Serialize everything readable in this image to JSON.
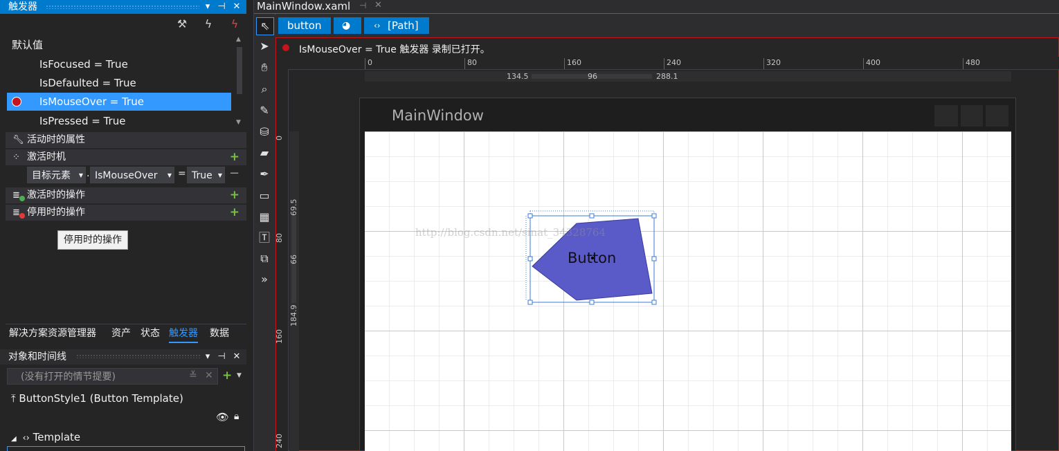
{
  "triggers_panel": {
    "title": "触发器",
    "default_label": "默认值",
    "triggers": [
      {
        "label": "IsFocused = True",
        "selected": false
      },
      {
        "label": "IsDefaulted = True",
        "selected": false
      },
      {
        "label": "IsMouseOver = True",
        "selected": true
      },
      {
        "label": "IsPressed = True",
        "selected": false
      }
    ],
    "sections": {
      "active_properties": "活动时的属性",
      "activation_timing": "激活时机",
      "activation_actions": "激活时的操作",
      "deactivation_actions": "停用时的操作"
    },
    "condition": {
      "target": "目标元素",
      "dot": ".",
      "property": "IsMouseOver",
      "equals": "=",
      "value": "True"
    },
    "tooltip": "停用时的操作"
  },
  "bottom_tabs": [
    "解决方案资源管理器",
    "资产",
    "状态",
    "触发器",
    "数据"
  ],
  "active_bottom_tab": "触发器",
  "objects_panel": {
    "title": "对象和时间线",
    "storyboard_placeholder": "(没有打开的情节提要)",
    "scope_label": "ButtonStyle1 (Button Template)",
    "tree_item": "Template"
  },
  "document": {
    "tab_title": "MainWindow.xaml",
    "breadcrumbs": [
      "button",
      "[Path]"
    ],
    "recording_status": "IsMouseOver = True 触发器 录制已打开。",
    "ruler_h_labels": [
      "0",
      "80",
      "160",
      "240",
      "320",
      "400",
      "480"
    ],
    "ruler_v_labels": [
      "0",
      "80",
      "160",
      "240"
    ],
    "dim_h": [
      "134.5",
      "96",
      "288.1"
    ],
    "dim_v": [
      "69.5",
      "66",
      "184.9"
    ],
    "window_title": "MainWindow",
    "button_text": "Button",
    "watermark": "http://blog.csdn.net/sinat_34328764"
  },
  "colors": {
    "accent": "#007acc",
    "selection": "#3399ff",
    "record": "#c5141b",
    "shape_fill": "#5a5ac8",
    "plus": "#76c043"
  }
}
